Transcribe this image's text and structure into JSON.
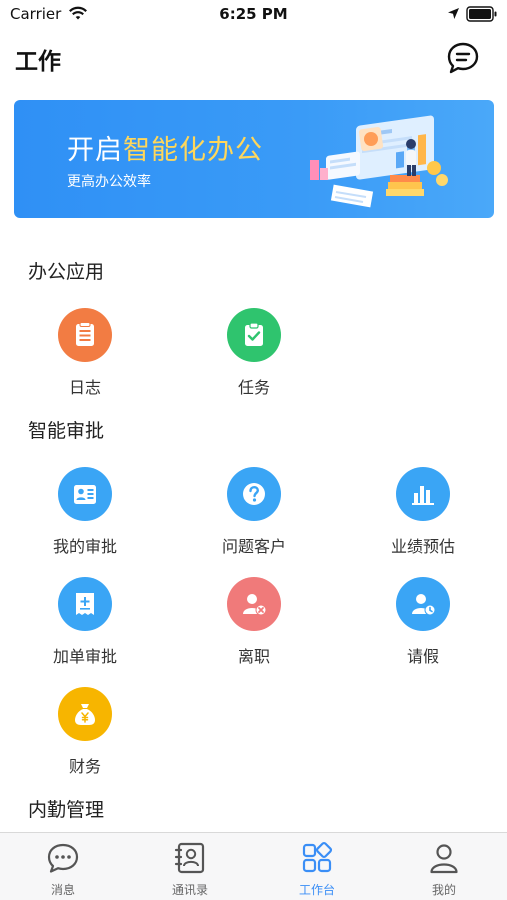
{
  "status_bar": {
    "carrier": "Carrier",
    "time": "6:25 PM"
  },
  "nav": {
    "title": "工作",
    "chat_icon": "chat-bubble-icon"
  },
  "banner": {
    "title_plain": "开启",
    "title_highlight": "智能化办公",
    "subtitle": "更高办公效率"
  },
  "sections": {
    "office": {
      "title": "办公应用"
    },
    "approval": {
      "title": "智能审批"
    },
    "internal": {
      "title": "内勤管理"
    }
  },
  "apps": {
    "log": {
      "label": "日志",
      "icon": "notebook-icon",
      "color": "#f27c43"
    },
    "task": {
      "label": "任务",
      "icon": "clipboard-check-icon",
      "color": "#2fc46e"
    },
    "my_approval": {
      "label": "我的审批",
      "icon": "id-card-icon",
      "color": "#3aa5f5"
    },
    "problem_customer": {
      "label": "问题客户",
      "icon": "question-icon",
      "color": "#3aa5f5"
    },
    "performance": {
      "label": "业绩预估",
      "icon": "bar-chart-icon",
      "color": "#3aa5f5"
    },
    "add_order": {
      "label": "加单审批",
      "icon": "add-receipt-icon",
      "color": "#3aa5f5"
    },
    "resign": {
      "label": "离职",
      "icon": "user-remove-icon",
      "color": "#f07a7a"
    },
    "leave": {
      "label": "请假",
      "icon": "user-clock-icon",
      "color": "#3aa5f5"
    },
    "finance": {
      "label": "财务",
      "icon": "money-bag-icon",
      "color": "#f7b500"
    }
  },
  "tabs": [
    {
      "label": "消息",
      "icon": "message-icon",
      "active": false
    },
    {
      "label": "通讯录",
      "icon": "contacts-icon",
      "active": false
    },
    {
      "label": "工作台",
      "icon": "workbench-grid-icon",
      "active": true
    },
    {
      "label": "我的",
      "icon": "profile-icon",
      "active": false
    }
  ],
  "colors": {
    "accent": "#3a8ef6",
    "banner_blue": "#2f90f5",
    "highlight": "#ffd75a"
  }
}
